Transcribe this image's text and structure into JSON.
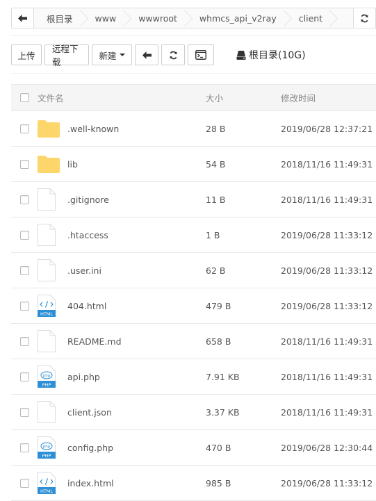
{
  "breadcrumb": {
    "back_icon": "arrow-left-icon",
    "items": [
      "根目录",
      "www",
      "wwwroot",
      "whmcs_api_v2ray",
      "client"
    ],
    "refresh_icon": "refresh-icon"
  },
  "toolbar": {
    "upload_label": "上传",
    "remote_download_label": "远程下载",
    "new_label": "新建",
    "back_icon": "arrow-left-icon",
    "refresh_icon": "refresh-icon",
    "terminal_icon": "terminal-icon",
    "disk_label": "根目录(10G)",
    "disk_icon": "hdd-icon"
  },
  "table": {
    "headers": {
      "name": "文件名",
      "size": "大小",
      "modified": "修改时间"
    },
    "rows": [
      {
        "icon": "folder",
        "name": ".well-known",
        "size": "28 B",
        "modified": "2019/06/28 12:37:21"
      },
      {
        "icon": "folder",
        "name": "lib",
        "size": "54 B",
        "modified": "2018/11/16 11:49:31"
      },
      {
        "icon": "file",
        "name": ".gitignore",
        "size": "11 B",
        "modified": "2018/11/16 11:49:31"
      },
      {
        "icon": "file",
        "name": ".htaccess",
        "size": "1 B",
        "modified": "2019/06/28 11:33:12"
      },
      {
        "icon": "file",
        "name": ".user.ini",
        "size": "62 B",
        "modified": "2019/06/28 11:33:12"
      },
      {
        "icon": "html",
        "name": "404.html",
        "size": "479 B",
        "modified": "2019/06/28 11:33:12"
      },
      {
        "icon": "file",
        "name": "README.md",
        "size": "658 B",
        "modified": "2018/11/16 11:49:31"
      },
      {
        "icon": "php",
        "name": "api.php",
        "size": "7.91 KB",
        "modified": "2018/11/16 11:49:31"
      },
      {
        "icon": "file",
        "name": "client.json",
        "size": "3.37 KB",
        "modified": "2018/11/16 11:49:31"
      },
      {
        "icon": "php",
        "name": "config.php",
        "size": "470 B",
        "modified": "2019/06/28 12:30:44"
      },
      {
        "icon": "html",
        "name": "index.html",
        "size": "985 B",
        "modified": "2019/06/28 11:33:12"
      }
    ]
  },
  "colors": {
    "folder": "#fcd56b",
    "html_badge": "#2d8fd6",
    "php_badge": "#2d8fd6",
    "border": "#dddddd"
  }
}
